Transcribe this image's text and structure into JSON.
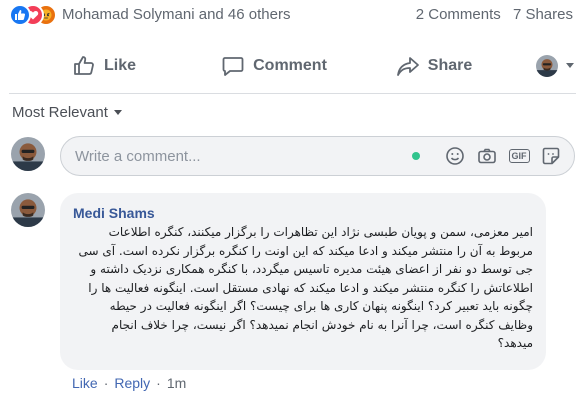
{
  "reactions": {
    "icons": [
      "like-icon",
      "love-icon",
      "angry-icon"
    ],
    "colors": {
      "like": "#1877f2",
      "love": "#f33e58",
      "angry": "#e9710f"
    },
    "summary": "Mohamad Solymani and 46 others",
    "comments_count": "2 Comments",
    "shares_count": "7 Shares"
  },
  "actions": {
    "like": "Like",
    "comment": "Comment",
    "share": "Share"
  },
  "sort": {
    "label": "Most Relevant"
  },
  "composer": {
    "placeholder": "Write a comment...",
    "gif_label": "GIF",
    "tools": [
      "emoji-icon",
      "camera-icon",
      "gif-icon",
      "sticker-icon"
    ]
  },
  "comment": {
    "author": "Medi Shams",
    "text": "امیر معزمی، سمن و پویان طبسی نژاد این تظاهرات را برگزار میکنند، کنگره اطلاعات مربوط به آن را منتشر میکند و ادعا میکند که این اونت را کنگره برگزار نکرده است. آی سی جی توسط دو نفر از اعضای هیئت مدیره تاسیس میگردد، با کنگره همکاری نزدیک داشته و اطلاعاتش را کنگره منتشر میکند و ادعا میکند که نهادی مستقل است. اینگونه فعالیت ها را چگونه باید تعبیر کرد؟ اینگونه پنهان کاری ها برای چیست؟ اگر اینگونه فعالیت در حیطه وظایف کنگره است، چرا آنرا به نام خودش انجام نمیدهد؟ اگر نیست، چرا خلاف انجام میدهد؟",
    "like_label": "Like",
    "reply_label": "Reply",
    "time": "1m"
  }
}
